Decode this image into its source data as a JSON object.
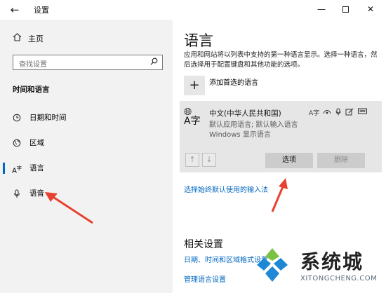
{
  "window": {
    "title": "设置",
    "back_glyph": "←",
    "min_glyph": "—",
    "close_glyph": "✕"
  },
  "sidebar": {
    "home_label": "主页",
    "search_placeholder": "查找设置",
    "section_title": "时间和语言",
    "items": [
      {
        "label": "日期和时间",
        "icon": "clock-icon"
      },
      {
        "label": "区域",
        "icon": "globe-icon"
      },
      {
        "label": "语言",
        "icon": "language-icon",
        "active": true
      },
      {
        "label": "语音",
        "icon": "microphone-icon"
      }
    ]
  },
  "main": {
    "title": "语言",
    "description": "应用和网站将以列表中支持的第一种语言显示。选择一种语言，然后选择用于配置键盘和其他功能的选项。",
    "add_language_label": "添加首选的语言",
    "language_card": {
      "name": "中文(中华人民共和国)",
      "detail_line1": "默认应用语言; 默认输入语言",
      "detail_line2": "Windows 显示语言",
      "options_button": "选项",
      "remove_button": "删除"
    },
    "input_method_link": "选择始终默认使用的输入法",
    "related_title": "相关设置",
    "date_link": "日期、时间和区域格式设置",
    "admin_link": "管理语言设置"
  },
  "watermark": {
    "brand": "系统城",
    "url": "XITONGCHENG.COM"
  },
  "colors": {
    "accent": "#0067c0",
    "annotation_arrow": "#e8402e",
    "sidebar_bg": "#f2f2f2"
  }
}
